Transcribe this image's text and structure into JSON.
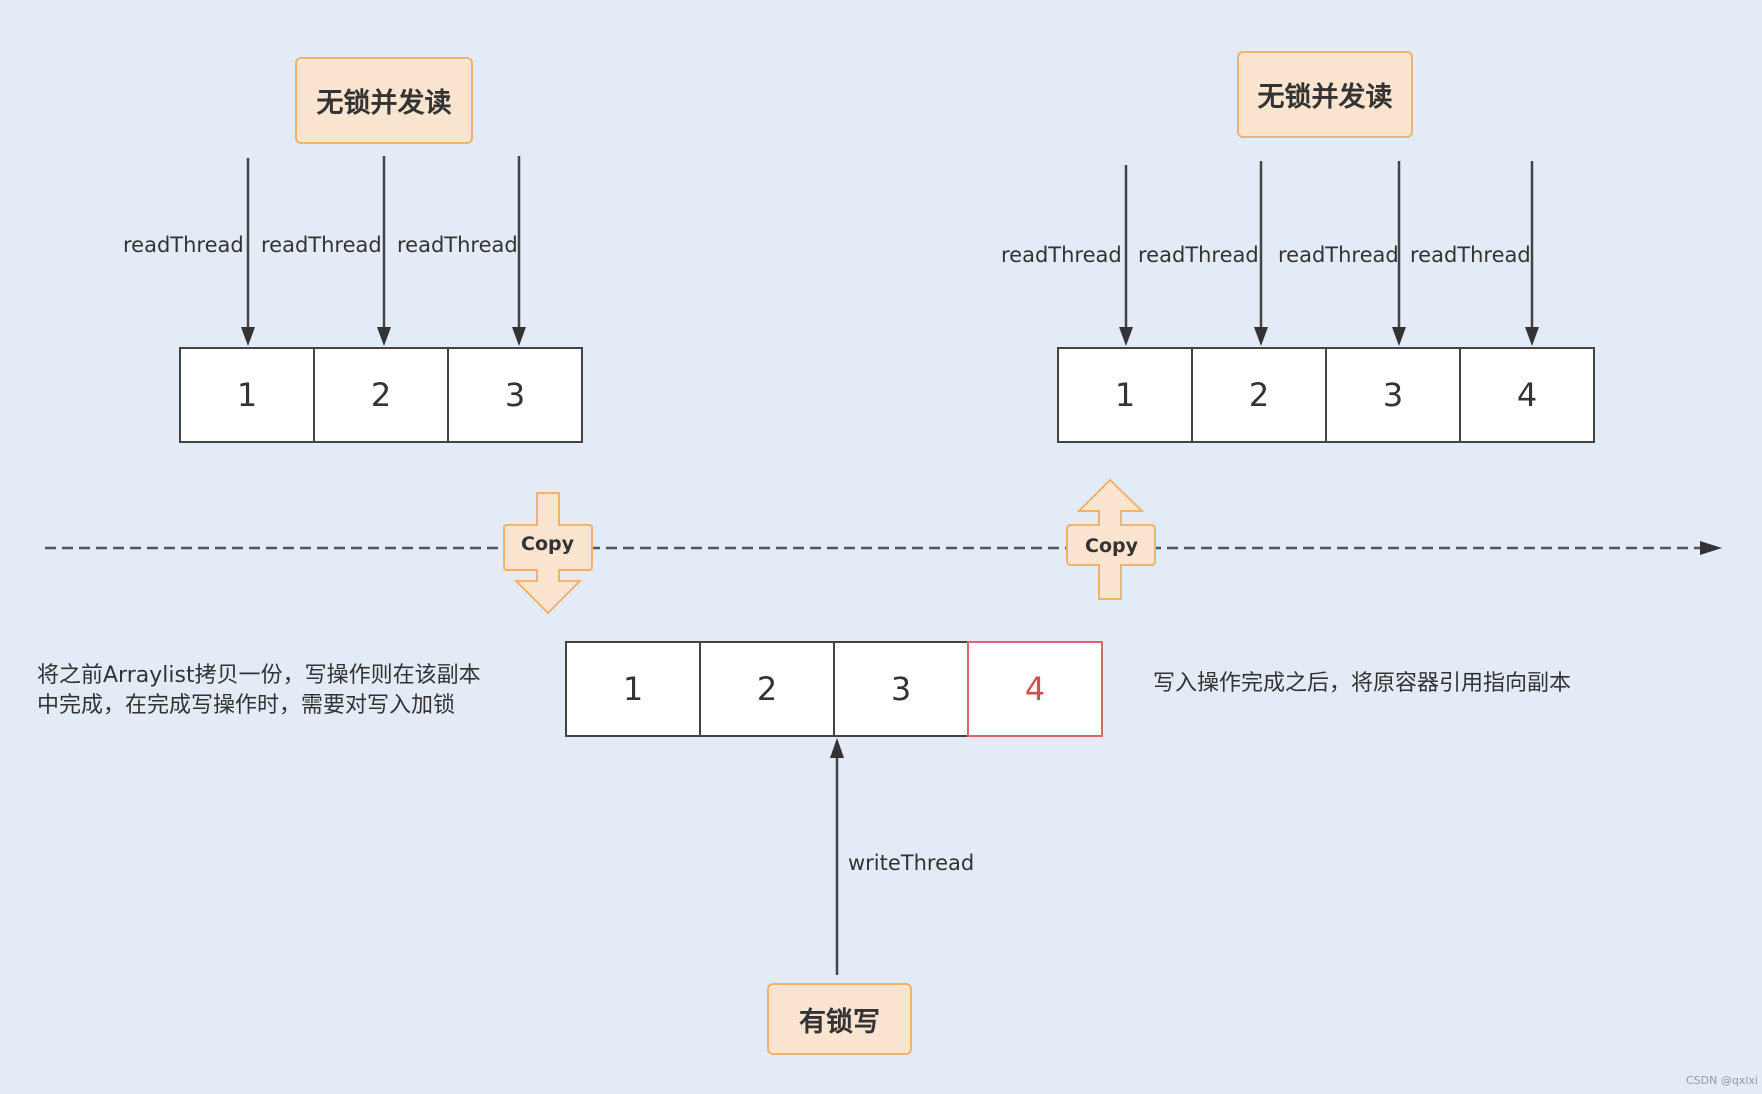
{
  "top_left": {
    "title": "无锁并发读",
    "thread_labels": [
      "readThread",
      "readThread",
      "readThread"
    ],
    "cells": [
      "1",
      "2",
      "3"
    ]
  },
  "top_right": {
    "title": "无锁并发读",
    "thread_labels": [
      "readThread",
      "readThread",
      "readThread",
      "readThread"
    ],
    "cells": [
      "1",
      "2",
      "3",
      "4"
    ]
  },
  "copy_down": {
    "label": "Copy"
  },
  "copy_up": {
    "label": "Copy"
  },
  "bottom": {
    "cells": [
      "1",
      "2",
      "3",
      "4"
    ],
    "new_cell_color": "#d0504f",
    "write_label": "writeThread",
    "writer_title": "有锁写"
  },
  "notes": {
    "left_line1": "将之前Arraylist拷贝一份，写操作则在该副本",
    "left_line2": "中完成，在完成写操作时，需要对写入加锁",
    "right": "写入操作完成之后，将原容器引用指向副本"
  },
  "colors": {
    "background": "#e3ebf6",
    "box_fill": "#fbe5d0",
    "box_border": "#eeb36e",
    "line": "#444444",
    "highlight": "#d9676a"
  },
  "watermark": "CSDN @qxlxi"
}
